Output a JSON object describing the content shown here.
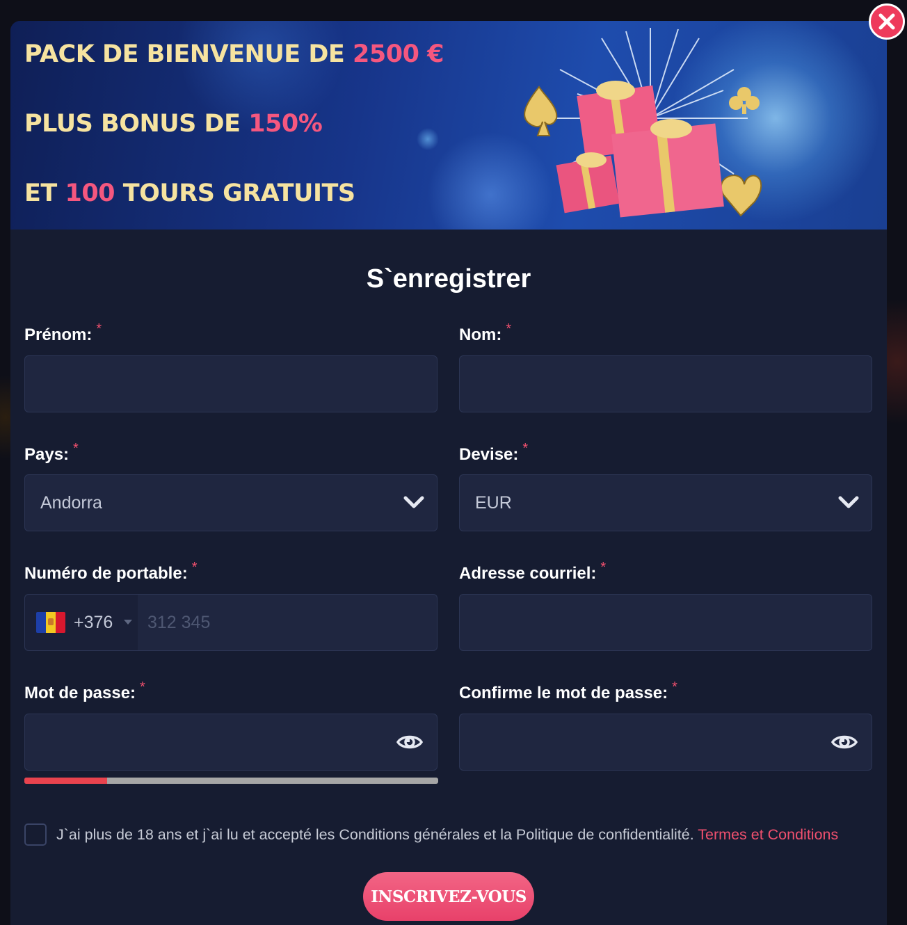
{
  "banner": {
    "line1_text": "PACK DE BIENVENUE DE ",
    "line1_highlight": "2500 €",
    "line2_text": "PLUS BONUS DE ",
    "line2_highlight": "150%",
    "line3_text": "ET ",
    "line3_highlight": "100",
    "line3_rest": " TOURS GRATUITS"
  },
  "form": {
    "title": "S`enregistrer",
    "required_mark": "*",
    "first_name": {
      "label": "Prénom:",
      "value": ""
    },
    "last_name": {
      "label": "Nom:",
      "value": ""
    },
    "country": {
      "label": "Pays:",
      "value": "Andorra"
    },
    "currency": {
      "label": "Devise:",
      "value": "EUR"
    },
    "phone": {
      "label": "Numéro de portable:",
      "dial_code": "+376",
      "placeholder": "312 345"
    },
    "email": {
      "label": "Adresse courriel:",
      "value": ""
    },
    "password": {
      "label": "Mot de passe:",
      "value": ""
    },
    "password_confirm": {
      "label": "Confirme le mot de passe:",
      "value": ""
    },
    "password_strength": 0.2,
    "terms": {
      "text": "J`ai plus de 18 ans et j`ai lu et accepté les Conditions générales et la Politique de confidentialité. ",
      "link": "Termes et Conditions",
      "checked": false
    },
    "submit_label": "INSCRIVEZ-VOUS"
  },
  "icons": {
    "close": "close-icon",
    "dropdown": "chevron-down-icon",
    "show_password": "eye-icon",
    "flag": "andorra-flag-icon"
  },
  "colors": {
    "accent": "#f0506e",
    "banner_text": "#f6e3a0",
    "modal_background": "#161c31",
    "field_background": "#1f2640",
    "button": "#e8416a",
    "strength_weak": "#e9434e"
  }
}
